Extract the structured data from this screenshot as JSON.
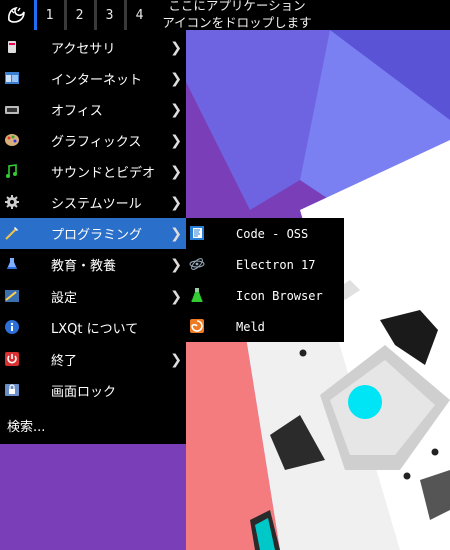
{
  "panel": {
    "desktops": [
      "1",
      "2",
      "3",
      "4"
    ],
    "active_desktop": "1",
    "drop_hint_line1": "ここにアプリケーション",
    "drop_hint_line2": "アイコンをドロップします"
  },
  "main_menu": {
    "items": [
      {
        "label": "アクセサリ",
        "icon": "accessories-icon",
        "submenu": true
      },
      {
        "label": "インターネット",
        "icon": "internet-icon",
        "submenu": true
      },
      {
        "label": "オフィス",
        "icon": "office-icon",
        "submenu": true
      },
      {
        "label": "グラフィックス",
        "icon": "graphics-icon",
        "submenu": true
      },
      {
        "label": "サウンドとビデオ",
        "icon": "sound-video-icon",
        "submenu": true
      },
      {
        "label": "システムツール",
        "icon": "system-tools-icon",
        "submenu": true
      },
      {
        "label": "プログラミング",
        "icon": "programming-icon",
        "submenu": true,
        "highlighted": true
      },
      {
        "label": "教育・教養",
        "icon": "education-icon",
        "submenu": true
      },
      {
        "label": "設定",
        "icon": "settings-icon",
        "submenu": true
      },
      {
        "label": "LXQt について",
        "icon": "info-icon",
        "submenu": false
      },
      {
        "label": "終了",
        "icon": "power-icon",
        "submenu": true
      },
      {
        "label": "画面ロック",
        "icon": "lock-screen-icon",
        "submenu": false
      }
    ],
    "search_label": "検索..."
  },
  "programming_submenu": {
    "items": [
      {
        "label": "Code - OSS",
        "icon": "code-oss-icon"
      },
      {
        "label": "Electron 17",
        "icon": "electron-icon"
      },
      {
        "label": "Icon Browser",
        "icon": "icon-browser-icon"
      },
      {
        "label": "Meld",
        "icon": "meld-icon"
      }
    ]
  },
  "colors": {
    "menu_background": "#000000",
    "highlight": "#2a6fc9",
    "wallpaper_purple": "#7a3fb8",
    "wallpaper_blue": "#7480f0",
    "wallpaper_pink": "#f57a80"
  }
}
